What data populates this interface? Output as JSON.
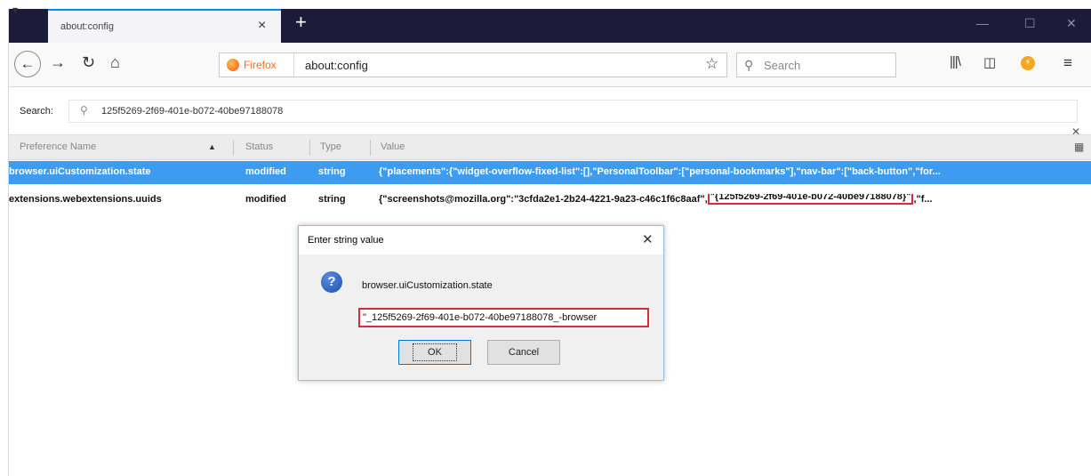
{
  "browser": {
    "tab_title": "about:config",
    "new_tab_symbol": "+",
    "brand_label": "Firefox",
    "url": "about:config",
    "search_placeholder": "Search",
    "window_controls": [
      "—",
      "☐",
      "✕"
    ]
  },
  "icons": {
    "back": "back-arrow-icon",
    "forward": "forward-arrow-icon",
    "reload": "reload-icon",
    "home": "home-icon",
    "bookmark": "star-icon",
    "library": "library-icon",
    "sidebar": "sidebar-icon",
    "extension": "extension-icon",
    "menu": "hamburger-menu-icon"
  },
  "config": {
    "search_label": "Search:",
    "search_value": "125f5269-2f69-401e-b072-40be97188078",
    "columns": [
      "Preference Name",
      "Status",
      "Type",
      "Value"
    ],
    "rows": [
      {
        "name": "browser.uiCustomization.state",
        "status": "modified",
        "type": "string",
        "value": "{\"placements\":{\"widget-overflow-fixed-list\":[],\"PersonalToolbar\":[\"personal-bookmarks\"],\"nav-bar\":[\"back-button\",\"for..."
      },
      {
        "name": "extensions.webextensions.uuids",
        "status": "modified",
        "type": "string",
        "value_prefix": "{\"screenshots@mozilla.org\":\"3cfda2e1-2b24-4221-9a23-c46c1f6c8aaf\",",
        "value_highlight": "\"{125f5269-2f69-401e-b072-40be97188078}\"",
        "value_suffix": ",\"f..."
      }
    ]
  },
  "dialog": {
    "title": "Enter string value",
    "message": "browser.uiCustomization.state",
    "input_value": "\"_125f5269-2f69-401e-b072-40be97188078_-browser",
    "ok_label": "OK",
    "cancel_label": "Cancel"
  },
  "colors": {
    "tab_bar": "#1c1b3a",
    "selected_row": "#3d9cf0",
    "highlight_border": "#d82c3d"
  }
}
